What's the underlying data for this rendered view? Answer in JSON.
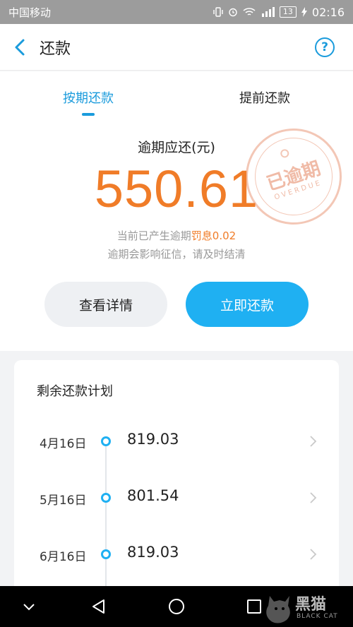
{
  "status": {
    "carrier": "中国移动",
    "battery": "13",
    "time": "02:16"
  },
  "header": {
    "title": "还款",
    "help_label": "?"
  },
  "tabs": [
    {
      "label": "按期还款",
      "active": true
    },
    {
      "label": "提前还款",
      "active": false
    }
  ],
  "summary": {
    "label": "逾期应还(元)",
    "amount": "550.61",
    "note_prefix": "当前已产生逾期",
    "penalty": "罚息0.02",
    "note2": "逾期会影响征信，请及时结清",
    "stamp_text": "已逾期",
    "stamp_subtext": "OVERDUE"
  },
  "actions": {
    "detail_label": "查看详情",
    "pay_label": "立即还款"
  },
  "plan": {
    "title": "剩余还款计划",
    "items": [
      {
        "date": "4月16日",
        "amount": "819.03"
      },
      {
        "date": "5月16日",
        "amount": "801.54"
      },
      {
        "date": "6月16日",
        "amount": "819.03"
      }
    ]
  },
  "watermark": {
    "title": "黑猫",
    "subtitle": "BLACK CAT"
  },
  "colors": {
    "accent": "#1fb0f2",
    "overdue": "#f07c28"
  },
  "icons": [
    "back-chevron-icon",
    "help-icon",
    "chevron-right-icon",
    "nav-back-icon",
    "nav-home-icon",
    "nav-recents-icon",
    "nav-down-icon"
  ]
}
